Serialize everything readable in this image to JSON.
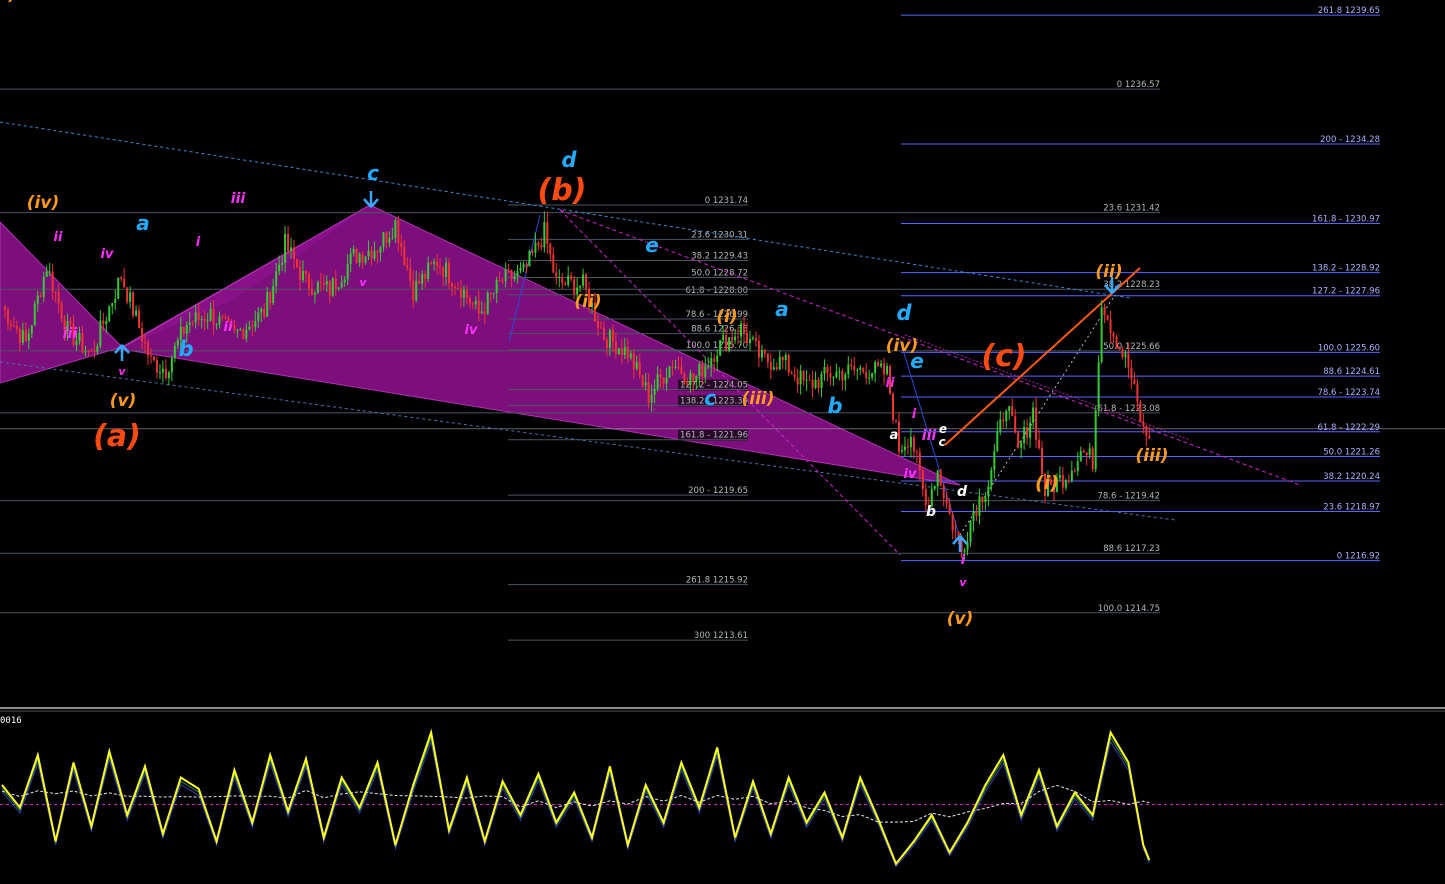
{
  "colors": {
    "background": "#000000",
    "bull": "#33cc33",
    "bear": "#ee3333",
    "fib_blue": "#5a66ff",
    "fib_gray": "#4a5560",
    "wave_orange": "#ff9a1a",
    "wave_red": "#ff4a10",
    "wave_blue": "#22aaff",
    "wave_magenta": "#ff30ff",
    "wave_white": "#ffffff",
    "pattern_fill": "#8a118a",
    "osc_main": "#ffff22",
    "osc_signal1": "#2a8f4a",
    "osc_signal2": "#3a3aaa",
    "osc_ma": "#e8e8e8",
    "osc_zero": "#cc22cc"
  },
  "chart_data": [
    {
      "type": "candlestick",
      "title": "",
      "ylim": [
        1211.4,
        1240.8
      ],
      "ohlc_zigzag": [
        {
          "i": 0,
          "p": 1227.5
        },
        {
          "i": 8,
          "p": 1226.0
        },
        {
          "i": 15,
          "p": 1229.2
        },
        {
          "i": 22,
          "p": 1226.5
        },
        {
          "i": 30,
          "p": 1225.5
        },
        {
          "i": 40,
          "p": 1228.8
        },
        {
          "i": 50,
          "p": 1225.2
        },
        {
          "i": 55,
          "p": 1224.9
        },
        {
          "i": 62,
          "p": 1226.8
        },
        {
          "i": 70,
          "p": 1227.2
        },
        {
          "i": 78,
          "p": 1226.3
        },
        {
          "i": 88,
          "p": 1227.3
        },
        {
          "i": 95,
          "p": 1230.1
        },
        {
          "i": 102,
          "p": 1228.5
        },
        {
          "i": 110,
          "p": 1228.2
        },
        {
          "i": 118,
          "p": 1229.6
        },
        {
          "i": 126,
          "p": 1230.0
        },
        {
          "i": 132,
          "p": 1231.0
        },
        {
          "i": 138,
          "p": 1228.2
        },
        {
          "i": 146,
          "p": 1229.4
        },
        {
          "i": 154,
          "p": 1228.3
        },
        {
          "i": 160,
          "p": 1227.2
        },
        {
          "i": 168,
          "p": 1228.6
        },
        {
          "i": 175,
          "p": 1228.9
        },
        {
          "i": 182,
          "p": 1230.6
        },
        {
          "i": 186,
          "p": 1228.5
        },
        {
          "i": 195,
          "p": 1228.4
        },
        {
          "i": 202,
          "p": 1226.3
        },
        {
          "i": 210,
          "p": 1225.6
        },
        {
          "i": 217,
          "p": 1223.8
        },
        {
          "i": 225,
          "p": 1225.2
        },
        {
          "i": 232,
          "p": 1224.4
        },
        {
          "i": 240,
          "p": 1225.8
        },
        {
          "i": 248,
          "p": 1226.6
        },
        {
          "i": 255,
          "p": 1225.3
        },
        {
          "i": 262,
          "p": 1225.2
        },
        {
          "i": 270,
          "p": 1224.2
        },
        {
          "i": 278,
          "p": 1224.7
        },
        {
          "i": 290,
          "p": 1224.9
        },
        {
          "i": 297,
          "p": 1224.7
        },
        {
          "i": 301,
          "p": 1221.6
        },
        {
          "i": 305,
          "p": 1222.2
        },
        {
          "i": 310,
          "p": 1219.2
        },
        {
          "i": 314,
          "p": 1220.7
        },
        {
          "i": 318,
          "p": 1218.8
        },
        {
          "i": 322,
          "p": 1217.3
        },
        {
          "i": 326,
          "p": 1219.0
        },
        {
          "i": 331,
          "p": 1220.2
        },
        {
          "i": 337,
          "p": 1223.6
        },
        {
          "i": 341,
          "p": 1221.4
        },
        {
          "i": 346,
          "p": 1223.2
        },
        {
          "i": 350,
          "p": 1219.8
        },
        {
          "i": 358,
          "p": 1220.6
        },
        {
          "i": 362,
          "p": 1221.5
        },
        {
          "i": 366,
          "p": 1221.1
        },
        {
          "i": 369,
          "p": 1227.8
        },
        {
          "i": 373,
          "p": 1226.4
        },
        {
          "i": 378,
          "p": 1225.0
        },
        {
          "i": 383,
          "p": 1222.3
        },
        {
          "i": 385,
          "p": 1222.0
        }
      ],
      "fib_sets": [
        {
          "name": "left",
          "levels": [
            {
              "label": "0 1231.74",
              "price": 1231.74
            },
            {
              "label": "23.6 1230.31",
              "price": 1230.31
            },
            {
              "label": "38.2 1229.43",
              "price": 1229.43
            },
            {
              "label": "50.0 1228.72",
              "price": 1228.72
            },
            {
              "label": "61.8 - 1228.00",
              "price": 1228.0
            },
            {
              "label": "78.6 - 1226.99",
              "price": 1226.99
            },
            {
              "label": "88.6 1226.38",
              "price": 1226.38
            },
            {
              "label": "100.0 1225.70",
              "price": 1225.7
            },
            {
              "label": "127.2 - 1224.05",
              "price": 1224.05
            },
            {
              "label": "138.2 - 1223.39",
              "price": 1223.39
            },
            {
              "label": "161.8 - 1221.96",
              "price": 1221.96
            },
            {
              "label": "200 - 1219.65",
              "price": 1219.65
            },
            {
              "label": "261.8 1215.92",
              "price": 1215.92
            },
            {
              "label": "300 1213.61",
              "price": 1213.61
            }
          ]
        },
        {
          "name": "middle",
          "levels": [
            {
              "label": "0 1236.57",
              "price": 1236.57
            },
            {
              "label": "23.6 1231.42",
              "price": 1231.42
            },
            {
              "label": "38.2 1228.23",
              "price": 1228.23
            },
            {
              "label": "50.0 1225.66",
              "price": 1225.66
            },
            {
              "label": "61.8 - 1223.08",
              "price": 1223.08
            },
            {
              "label": "78.6 - 1219.42",
              "price": 1219.42
            },
            {
              "label": "88.6 1217.23",
              "price": 1217.23
            },
            {
              "label": "100.0 1214.75",
              "price": 1214.75
            }
          ]
        },
        {
          "name": "right",
          "levels": [
            {
              "label": "261.8 1239.65",
              "price": 1239.65
            },
            {
              "label": "200 - 1234.28",
              "price": 1234.28
            },
            {
              "label": "161.8 - 1230.97",
              "price": 1230.97
            },
            {
              "label": "138.2 - 1228.92",
              "price": 1228.92
            },
            {
              "label": "127.2 - 1227.96",
              "price": 1227.96
            },
            {
              "label": "100.0 1225.60",
              "price": 1225.6
            },
            {
              "label": "88.6 1224.61",
              "price": 1224.61
            },
            {
              "label": "78.6 - 1223.74",
              "price": 1223.74
            },
            {
              "label": "61.8 - 1222.29",
              "price": 1222.29
            },
            {
              "label": "50.0 1221.26",
              "price": 1221.26
            },
            {
              "label": "38.2 1220.24",
              "price": 1220.24
            },
            {
              "label": "23.6 1218.97",
              "price": 1218.97
            },
            {
              "label": "0 1216.92",
              "price": 1216.92
            }
          ]
        }
      ],
      "wave_labels": [
        {
          "text": "(iv)",
          "color": "orange",
          "size": 17
        },
        {
          "text": "ii",
          "color": "magenta",
          "size": 13
        },
        {
          "text": "a",
          "color": "blue",
          "size": 20
        },
        {
          "text": "iv",
          "color": "magenta",
          "size": 13
        },
        {
          "text": "iii",
          "color": "magenta",
          "size": 14
        },
        {
          "text": "i",
          "color": "magenta",
          "size": 13
        },
        {
          "text": "iii",
          "color": "magenta",
          "size": 14
        },
        {
          "text": "ii",
          "color": "magenta",
          "size": 13
        },
        {
          "text": "v",
          "color": "magenta",
          "size": 11
        },
        {
          "text": "b",
          "color": "blue",
          "size": 21
        },
        {
          "text": "(v)",
          "color": "orange",
          "size": 17
        },
        {
          "text": "(a)",
          "color": "red",
          "size": 30
        },
        {
          "text": "c",
          "color": "blue",
          "size": 20
        },
        {
          "text": "v",
          "color": "magenta",
          "size": 11
        },
        {
          "text": "iv",
          "color": "magenta",
          "size": 13
        },
        {
          "text": "d",
          "color": "blue",
          "size": 21
        },
        {
          "text": "(b)",
          "color": "red",
          "size": 30
        },
        {
          "text": "e",
          "color": "blue",
          "size": 20
        },
        {
          "text": "(ii)",
          "color": "orange",
          "size": 17
        },
        {
          "text": "(i)",
          "color": "orange",
          "size": 17
        },
        {
          "text": "a",
          "color": "blue",
          "size": 20
        },
        {
          "text": "c",
          "color": "blue",
          "size": 20
        },
        {
          "text": "(iii)",
          "color": "orange",
          "size": 17
        },
        {
          "text": "b",
          "color": "blue",
          "size": 21
        },
        {
          "text": "d",
          "color": "blue",
          "size": 21
        },
        {
          "text": "(iv)",
          "color": "orange",
          "size": 17
        },
        {
          "text": "e",
          "color": "blue",
          "size": 20
        },
        {
          "text": "ii",
          "color": "magenta",
          "size": 13
        },
        {
          "text": "i",
          "color": "magenta",
          "size": 13
        },
        {
          "text": "a",
          "color": "white",
          "size": 13
        },
        {
          "text": "iii",
          "color": "magenta",
          "size": 14
        },
        {
          "text": "c",
          "color": "white",
          "size": 12
        },
        {
          "text": "e",
          "color": "white",
          "size": 12
        },
        {
          "text": "iv",
          "color": "magenta",
          "size": 13
        },
        {
          "text": "b",
          "color": "white",
          "size": 14
        },
        {
          "text": "d",
          "color": "white",
          "size": 14
        },
        {
          "text": "i",
          "color": "magenta",
          "size": 13
        },
        {
          "text": "v",
          "color": "magenta",
          "size": 11
        },
        {
          "text": "(v)",
          "color": "orange",
          "size": 17
        },
        {
          "text": "(c)",
          "color": "red",
          "size": 30
        },
        {
          "text": "(i)",
          "color": "orange",
          "size": 19
        },
        {
          "text": "(ii)",
          "color": "orange",
          "size": 17
        },
        {
          "text": "(iii)",
          "color": "orange",
          "size": 17
        },
        {
          "text": "(iv)",
          "color": "orange",
          "size": 17
        }
      ]
    },
    {
      "type": "line",
      "title": "",
      "label": "0016",
      "ylim": [
        -1,
        1
      ],
      "zero_line": -0.06,
      "series_points": [
        [
          0,
          0.2
        ],
        [
          6,
          -0.1
        ],
        [
          12,
          0.6
        ],
        [
          18,
          -0.55
        ],
        [
          24,
          0.5
        ],
        [
          30,
          -0.35
        ],
        [
          36,
          0.65
        ],
        [
          42,
          -0.2
        ],
        [
          48,
          0.45
        ],
        [
          54,
          -0.45
        ],
        [
          60,
          0.3
        ],
        [
          66,
          0.15
        ],
        [
          72,
          -0.55
        ],
        [
          78,
          0.4
        ],
        [
          84,
          -0.3
        ],
        [
          90,
          0.6
        ],
        [
          96,
          -0.15
        ],
        [
          102,
          0.55
        ],
        [
          108,
          -0.5
        ],
        [
          114,
          0.3
        ],
        [
          120,
          -0.1
        ],
        [
          126,
          0.5
        ],
        [
          132,
          -0.6
        ],
        [
          138,
          0.2
        ],
        [
          144,
          0.9
        ],
        [
          150,
          -0.4
        ],
        [
          156,
          0.3
        ],
        [
          162,
          -0.55
        ],
        [
          168,
          0.25
        ],
        [
          174,
          -0.2
        ],
        [
          180,
          0.35
        ],
        [
          186,
          -0.3
        ],
        [
          192,
          0.1
        ],
        [
          198,
          -0.5
        ],
        [
          204,
          0.45
        ],
        [
          210,
          -0.6
        ],
        [
          216,
          0.2
        ],
        [
          222,
          -0.3
        ],
        [
          228,
          0.5
        ],
        [
          234,
          -0.1
        ],
        [
          240,
          0.7
        ],
        [
          246,
          -0.5
        ],
        [
          252,
          0.25
        ],
        [
          258,
          -0.45
        ],
        [
          264,
          0.3
        ],
        [
          270,
          -0.3
        ],
        [
          276,
          0.1
        ],
        [
          282,
          -0.5
        ],
        [
          288,
          0.3
        ],
        [
          294,
          -0.25
        ],
        [
          300,
          -0.85
        ],
        [
          306,
          -0.55
        ],
        [
          312,
          -0.2
        ],
        [
          318,
          -0.7
        ],
        [
          324,
          -0.3
        ],
        [
          330,
          0.2
        ],
        [
          336,
          0.6
        ],
        [
          342,
          -0.2
        ],
        [
          348,
          0.4
        ],
        [
          354,
          -0.35
        ],
        [
          360,
          0.1
        ],
        [
          366,
          -0.2
        ],
        [
          372,
          0.9
        ],
        [
          378,
          0.5
        ],
        [
          383,
          -0.6
        ],
        [
          385,
          -0.8
        ]
      ]
    }
  ]
}
